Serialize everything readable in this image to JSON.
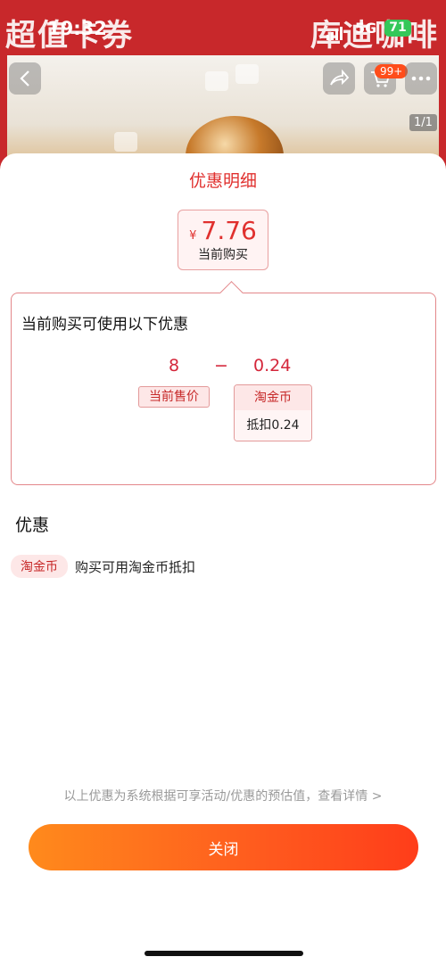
{
  "background": {
    "banner_left": "超值卡券",
    "banner_right": "库迪咖啡",
    "cart_badge": "99+",
    "page_indicator": "1/1"
  },
  "status_bar": {
    "time": "19:32",
    "network": "5G",
    "battery": "71"
  },
  "sheet": {
    "title": "优惠明细",
    "price": {
      "currency": "¥",
      "value": "7.76",
      "caption": "当前购买"
    },
    "detail": {
      "heading": "当前购买可使用以下优惠",
      "original": "8",
      "operator": "−",
      "discount": "0.24",
      "original_tag": "当前售价",
      "discount_tag_title": "淘金币",
      "discount_tag_value": "抵扣0.24"
    },
    "section_heading": "优惠",
    "promo": {
      "tag": "淘金币",
      "text": "购买可用淘金币抵扣"
    },
    "disclaimer": "以上优惠为系统根据可享活动/优惠的预估值，查看详情 >",
    "close_label": "关闭"
  },
  "colors": {
    "accent_red": "#e0302e",
    "button_gradient_start": "#ff8a1c",
    "button_gradient_end": "#ff3d1a"
  }
}
